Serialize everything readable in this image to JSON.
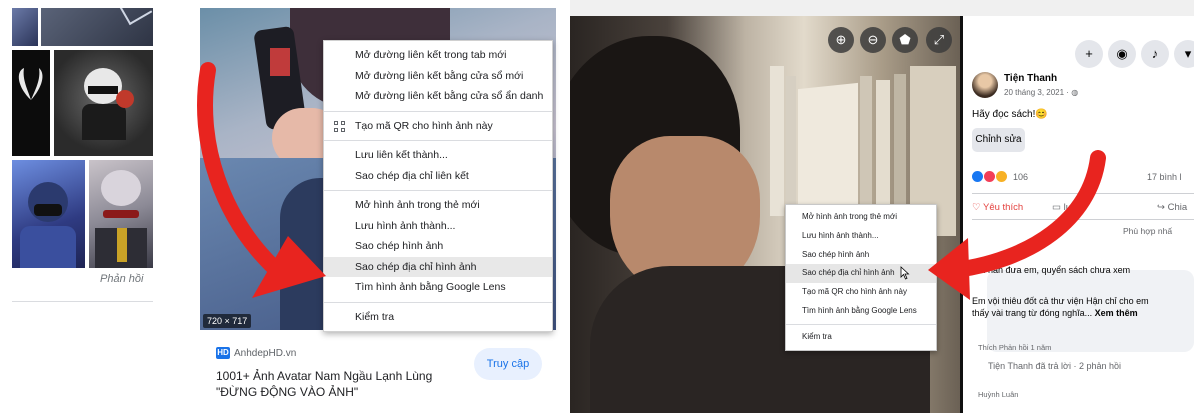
{
  "panel1": {
    "feedback_label": "Phản hồi"
  },
  "panel2": {
    "image_dimensions": "720 × 717",
    "context_menu": {
      "items": [
        "Mở đường liên kết trong tab mới",
        "Mở đường liên kết bằng cửa sổ mới",
        "Mở đường liên kết bằng cửa sổ ẩn danh",
        "Tạo mã QR cho hình ảnh này",
        "Lưu liên kết thành...",
        "Sao chép địa chỉ liên kết",
        "Mở hình ảnh trong thẻ mới",
        "Lưu hình ảnh thành...",
        "Sao chép hình ảnh",
        "Sao chép địa chỉ hình ảnh",
        "Tìm hình ảnh bằng Google Lens",
        "Kiểm tra"
      ],
      "highlighted": "Sao chép địa chỉ hình ảnh"
    },
    "result": {
      "site_badge": "HD",
      "site_name": "AnhdepHD.vn",
      "title": "1001+ Ảnh Avatar Nam Ngầu Lạnh Lùng \"ĐỪNG ĐỘNG VÀO ẢNH\"",
      "visit_button": "Truy cập"
    }
  },
  "panel3": {
    "context_menu": {
      "items": [
        "Mở hình ảnh trong thẻ mới",
        "Lưu hình ảnh thành...",
        "Sao chép hình ảnh",
        "Sao chép địa chỉ hình ảnh",
        "Tạo mã QR cho hình ảnh này",
        "Tìm hình ảnh bằng Google Lens",
        "Kiểm tra"
      ],
      "highlighted": "Sao chép địa chỉ hình ảnh"
    },
    "post": {
      "author": "Tiện Thanh",
      "date": "20 tháng 3, 2021 ·",
      "caption": "Hãy đọc sách!😊",
      "edit_button": "Chỉnh sửa",
      "reaction_count": "106",
      "share_count": "17 bình l",
      "like_label": "Yêu thích",
      "comment_label": "luận",
      "share_label": "Chia",
      "relevance_label": "Phù hợp nhấ",
      "comment_line1": "Hồi hẳn đưa em, quyển sách chưa xem",
      "comment_line2": "Em vội thiêu đốt cả thư viện Hận chỉ cho em thấy vài trang từ đóng nghĩa...",
      "see_more": "Xem thêm",
      "reply_actions": "Thích    Phản hồi    1 năm",
      "reply_note": "Tiện Thanh đã trả lời · 2 phản hồi",
      "next_commenter": "Huỳnh Luân"
    },
    "colors": {
      "arrow": "#e8241f",
      "like": "#e4423f",
      "link": "#1a73e8"
    }
  }
}
